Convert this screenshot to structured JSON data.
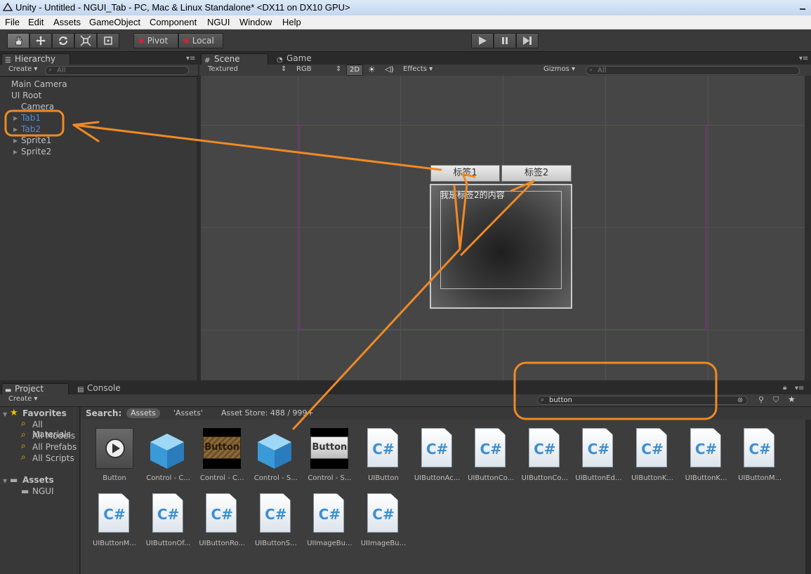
{
  "window": {
    "title": "Unity - Untitled - NGUI_Tab - PC, Mac & Linux Standalone* <DX11 on DX10 GPU>"
  },
  "menu": {
    "items": [
      "File",
      "Edit",
      "Assets",
      "GameObject",
      "Component",
      "NGUI",
      "Window",
      "Help"
    ]
  },
  "toolbar": {
    "tools": [
      "hand-icon",
      "move-icon",
      "rotate-icon",
      "scale-icon",
      "rect-icon"
    ],
    "pivot_label": "Pivot",
    "local_label": "Local"
  },
  "hierarchy": {
    "tab_label": "Hierarchy",
    "create_label": "Create",
    "search_placeholder": "All",
    "items": [
      {
        "label": "Main Camera"
      },
      {
        "label": "UI Root"
      },
      {
        "label": "Camera"
      },
      {
        "label": "Tab1"
      },
      {
        "label": "Tab2"
      },
      {
        "label": "Sprite1"
      },
      {
        "label": "Sprite2"
      }
    ]
  },
  "scene": {
    "tab_label": "Scene",
    "game_tab_label": "Game",
    "shading": "Textured",
    "color_mode": "RGB",
    "mode_2d": "2D",
    "effects_label": "Effects",
    "gizmos_label": "Gizmos",
    "search_placeholder": "All",
    "tab1_label": "标签1",
    "tab2_label": "标签2",
    "panel_text": "我是标签2的内容"
  },
  "project": {
    "tab_label": "Project",
    "console_tab_label": "Console",
    "create_label": "Create",
    "search_value": "button",
    "search_label": "Search:",
    "scope_assets": "Assets",
    "scope_assets_quoted": "'Assets'",
    "asset_store": "Asset Store: 488 / 999+",
    "favorites_label": "Favorites",
    "favorites": [
      "All Materials",
      "All Models",
      "All Prefabs",
      "All Scripts"
    ],
    "assets_label": "Assets",
    "folders": [
      "NGUI"
    ],
    "assets": [
      {
        "label": "Button",
        "kind": "button-prefab"
      },
      {
        "label": "Control - C...",
        "kind": "cube"
      },
      {
        "label": "Control - C...",
        "kind": "wood-button"
      },
      {
        "label": "Control - S...",
        "kind": "cube"
      },
      {
        "label": "Control - S...",
        "kind": "gray-button"
      },
      {
        "label": "UIButton",
        "kind": "cs"
      },
      {
        "label": "UIButtonAc...",
        "kind": "cs"
      },
      {
        "label": "UIButtonCo...",
        "kind": "cs"
      },
      {
        "label": "UIButtonCo...",
        "kind": "cs"
      },
      {
        "label": "UIButtonEd...",
        "kind": "cs"
      },
      {
        "label": "UIButtonK...",
        "kind": "cs"
      },
      {
        "label": "UIButtonK...",
        "kind": "cs"
      },
      {
        "label": "UIButtonM...",
        "kind": "cs"
      },
      {
        "label": "UIButtonM...",
        "kind": "cs"
      },
      {
        "label": "UIButtonOf...",
        "kind": "cs"
      },
      {
        "label": "UIButtonRo...",
        "kind": "cs"
      },
      {
        "label": "UIButtonS...",
        "kind": "cs"
      },
      {
        "label": "UIImageBu...",
        "kind": "cs"
      },
      {
        "label": "UIImageBu...",
        "kind": "cs"
      }
    ],
    "thumb_text": "Button",
    "cs_glyph": "C#"
  },
  "annotation_color": "#f08a24"
}
